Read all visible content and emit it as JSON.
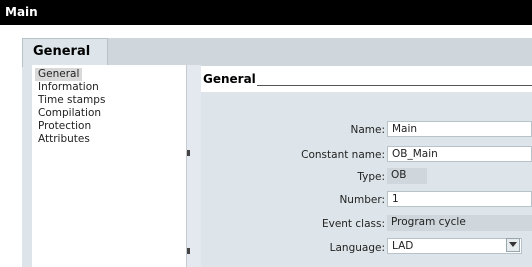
{
  "window": {
    "title": "Main"
  },
  "tabs": [
    {
      "label": "General"
    }
  ],
  "sidebar": {
    "items": [
      {
        "label": "General",
        "selected": true
      },
      {
        "label": "Information"
      },
      {
        "label": "Time stamps"
      },
      {
        "label": "Compilation"
      },
      {
        "label": "Protection"
      },
      {
        "label": "Attributes"
      }
    ]
  },
  "section": {
    "title": "General"
  },
  "form": {
    "name": {
      "label": "Name:",
      "value": "Main"
    },
    "constant_name": {
      "label": "Constant name:",
      "value": "OB_Main"
    },
    "type": {
      "label": "Type:",
      "value": "OB"
    },
    "number": {
      "label": "Number:",
      "value": "1"
    },
    "event_class": {
      "label": "Event class:",
      "value": "Program cycle"
    },
    "language": {
      "label": "Language:",
      "value": "LAD"
    }
  },
  "icons": {
    "dropdown": "chevron-down-icon"
  },
  "colors": {
    "title_bar": "#000000",
    "panel": "#dde5ea",
    "tab_strip": "#cfd7dc"
  }
}
